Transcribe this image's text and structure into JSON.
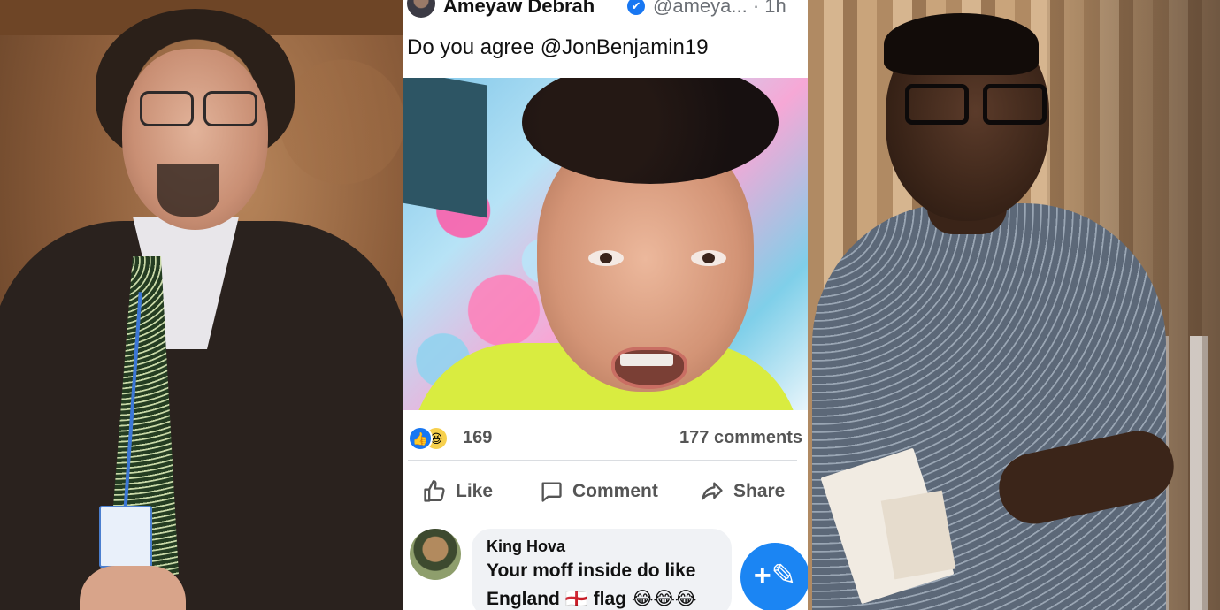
{
  "post": {
    "author": "Ameyaw Debrah",
    "verified_mark": "✔",
    "handle_time": "@ameya... · 1h",
    "caption": "Do you agree @JonBenjamin19",
    "reactions": {
      "like_glyph": "👍",
      "haha_glyph": "😆",
      "count": "169",
      "comments": "177 comments"
    },
    "actions": {
      "like": "Like",
      "comment": "Comment",
      "share": "Share"
    },
    "comment": {
      "name": "King Hova",
      "text": "Your moff inside do like England 🏴󠁧󠁢󠁥󠁮󠁧󠁿 flag 😂😂😂"
    },
    "fab_glyph": "+✎"
  },
  "colors": {
    "facebook_blue": "#1877f2",
    "text_secondary": "#555555",
    "bubble_bg": "#f0f2f5"
  },
  "icons": [
    "thumbs-up-icon",
    "comment-icon",
    "share-icon",
    "compose-icon",
    "verified-badge-icon"
  ]
}
